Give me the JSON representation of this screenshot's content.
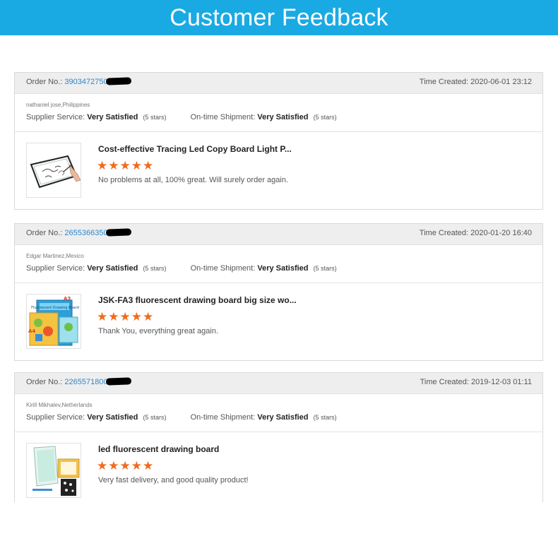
{
  "banner": {
    "title": "Customer Feedback"
  },
  "labels": {
    "order": "Order No.:",
    "time": "Time Created:",
    "supplier": "Supplier Service:",
    "shipment": "On-time Shipment:"
  },
  "orders": [
    {
      "order_no": "3903472750",
      "time_created": "2020-06-01 23:12",
      "buyer": "nathaniel jose,Philippines",
      "supplier_rating": "Very Satisfied",
      "supplier_stars": "(5 stars)",
      "shipment_rating": "Very Satisfied",
      "shipment_stars": "(5 stars)",
      "product_title": "Cost-effective Tracing Led Copy Board Light P...",
      "stars": "★★★★★",
      "comment": "No problems at all, 100% great. Will surely order again."
    },
    {
      "order_no": "2655366350",
      "time_created": "2020-01-20 16:40",
      "buyer": "Edgar Martinez,Mexico",
      "supplier_rating": "Very Satisfied",
      "supplier_stars": "(5 stars)",
      "shipment_rating": "Very Satisfied",
      "shipment_stars": "(5 stars)",
      "product_title": "JSK-FA3 fluorescent drawing board big size wo...",
      "stars": "★★★★★",
      "comment": "Thank You, everything great again.",
      "thumb_labels": {
        "a3": "A3",
        "a4": "A4",
        "box": "Fluorescent Drawing Board"
      }
    },
    {
      "order_no": "2265571800",
      "time_created": "2019-12-03 01:11",
      "buyer": "Kirill Mikhalev,Netherlands",
      "supplier_rating": "Very Satisfied",
      "supplier_stars": "(5 stars)",
      "shipment_rating": "Very Satisfied",
      "shipment_stars": "(5 stars)",
      "product_title": "led fluorescent drawing board",
      "stars": "★★★★★",
      "comment": "Very fast delivery, and good quality product!"
    }
  ],
  "colors": {
    "banner": "#1aaae3",
    "link": "#2f86c9",
    "star": "#f06b1a"
  }
}
